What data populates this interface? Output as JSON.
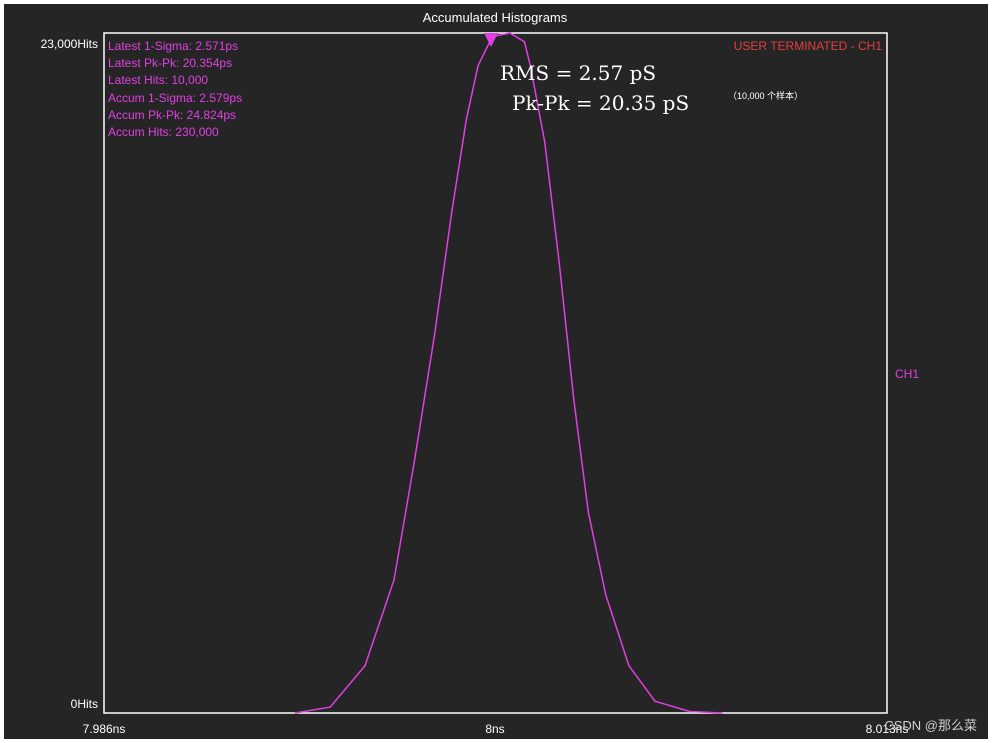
{
  "chart_data": {
    "type": "line",
    "title": "Accumulated Histograms",
    "xlabel": "",
    "ylabel": "",
    "xlim": [
      7.986,
      8.013
    ],
    "ylim": [
      0,
      23000
    ],
    "x_ticks": [
      "7.986ns",
      "8ns",
      "8.013ns"
    ],
    "y_ticks": [
      "0Hits",
      "23,000Hits"
    ],
    "grid": false,
    "series": [
      {
        "name": "CH1",
        "color": "#e040e0",
        "x": [
          7.9926,
          7.9938,
          7.995,
          7.996,
          7.9967,
          7.9974,
          7.998,
          7.9985,
          7.9989,
          7.9993,
          7.9995,
          8.0,
          8.0005,
          8.0007,
          8.0012,
          8.0017,
          8.0022,
          8.0027,
          8.0033,
          8.0041,
          8.005,
          8.0062,
          8.0073
        ],
        "y": [
          0,
          200,
          1600,
          4500,
          8500,
          12800,
          17000,
          20100,
          21900,
          22700,
          22900,
          23000,
          22700,
          21900,
          19300,
          15200,
          10600,
          6800,
          4000,
          1600,
          400,
          50,
          0
        ]
      }
    ],
    "stats": [
      "Latest 1-Sigma: 2.571ps",
      "Latest Pk-Pk: 20.354ps",
      "Latest Hits: 10,000",
      "Accum 1-Sigma: 2.579ps",
      "Accum Pk-Pk: 24.824ps",
      "Accum Hits: 230,000"
    ],
    "status_text": "USER TERMINATED - CH1",
    "channel_label": "CH1",
    "annotations": {
      "rms": "RMS = 2.57 pS",
      "pkpk": "Pk-Pk = 20.35 pS",
      "samples": "（10,000 个样本）"
    }
  },
  "watermark": "CSDN @那么菜",
  "colors": {
    "background": "#252526",
    "plot_border": "#ffffff",
    "trace": "#e040e0",
    "stats_text": "#e040e0",
    "status_text": "#e04040",
    "axis_text": "#ffffff"
  }
}
